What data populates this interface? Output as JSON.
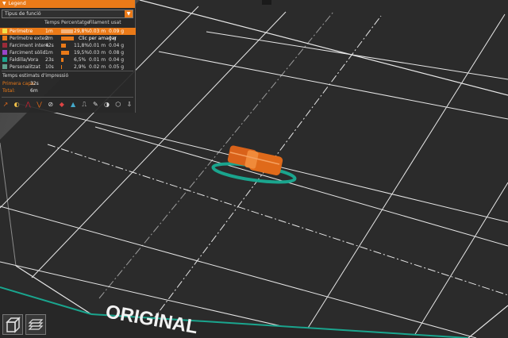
{
  "legend": {
    "title": "Legend",
    "combo_value": "Tipus de funció",
    "columns": {
      "time": "Temps",
      "percentage": "Percentatge",
      "filament": "Filament usat"
    },
    "rows": [
      {
        "label": "Perímetre",
        "time": "1m",
        "percent": "29,8%",
        "length": "0.03 m",
        "weight": "0.09 g",
        "color": "#f0e04a",
        "fraction": 0.298,
        "selected": true
      },
      {
        "label": "Perímetre extern",
        "time": "2m",
        "percent": "",
        "length": "",
        "weight": "0 g",
        "color": "#ea7a18",
        "fraction": 0.31,
        "selected": false,
        "tooltip": "Clic per amagar"
      },
      {
        "label": "Farciment intern",
        "time": "42s",
        "percent": "11,8%",
        "length": "0.01 m",
        "weight": "0.04 g",
        "color": "#9b2b3a",
        "fraction": 0.118,
        "selected": false
      },
      {
        "label": "Farciment sòlid",
        "time": "1m",
        "percent": "19,5%",
        "length": "0.03 m",
        "weight": "0.08 g",
        "color": "#9a45c9",
        "fraction": 0.195,
        "selected": false
      },
      {
        "label": "Faldilla/Vora",
        "time": "23s",
        "percent": "6,5%",
        "length": "0.01 m",
        "weight": "0.04 g",
        "color": "#1aa58e",
        "fraction": 0.065,
        "selected": false
      },
      {
        "label": "Personalitzat",
        "time": "10s",
        "percent": "2,9%",
        "length": "0.02 m",
        "weight": "0.05 g",
        "color": "#5fa18e",
        "fraction": 0.029,
        "selected": false
      }
    ],
    "estimated_title": "Temps estimats d'impressió",
    "first_layer_label": "Primera capa:",
    "first_layer_value": "32s",
    "total_label": "Total:",
    "total_value": "6m",
    "icons": [
      "travel-icon",
      "wipe-icon",
      "retract-icon",
      "deretract-icon",
      "seam-icon",
      "tool-change-icon",
      "color-change-icon",
      "pause-icon",
      "custom-gcode-icon",
      "center-of-gravity-icon",
      "shells-icon",
      "tool-marker-icon"
    ]
  },
  "bed": {
    "logo_text": "ORIGINAL"
  },
  "colors": {
    "accent": "#ea7a18",
    "bed": "#2c2c2c",
    "grid": "#e8e8e8",
    "object": "#e06a1a",
    "skirt": "#1aa58e"
  }
}
